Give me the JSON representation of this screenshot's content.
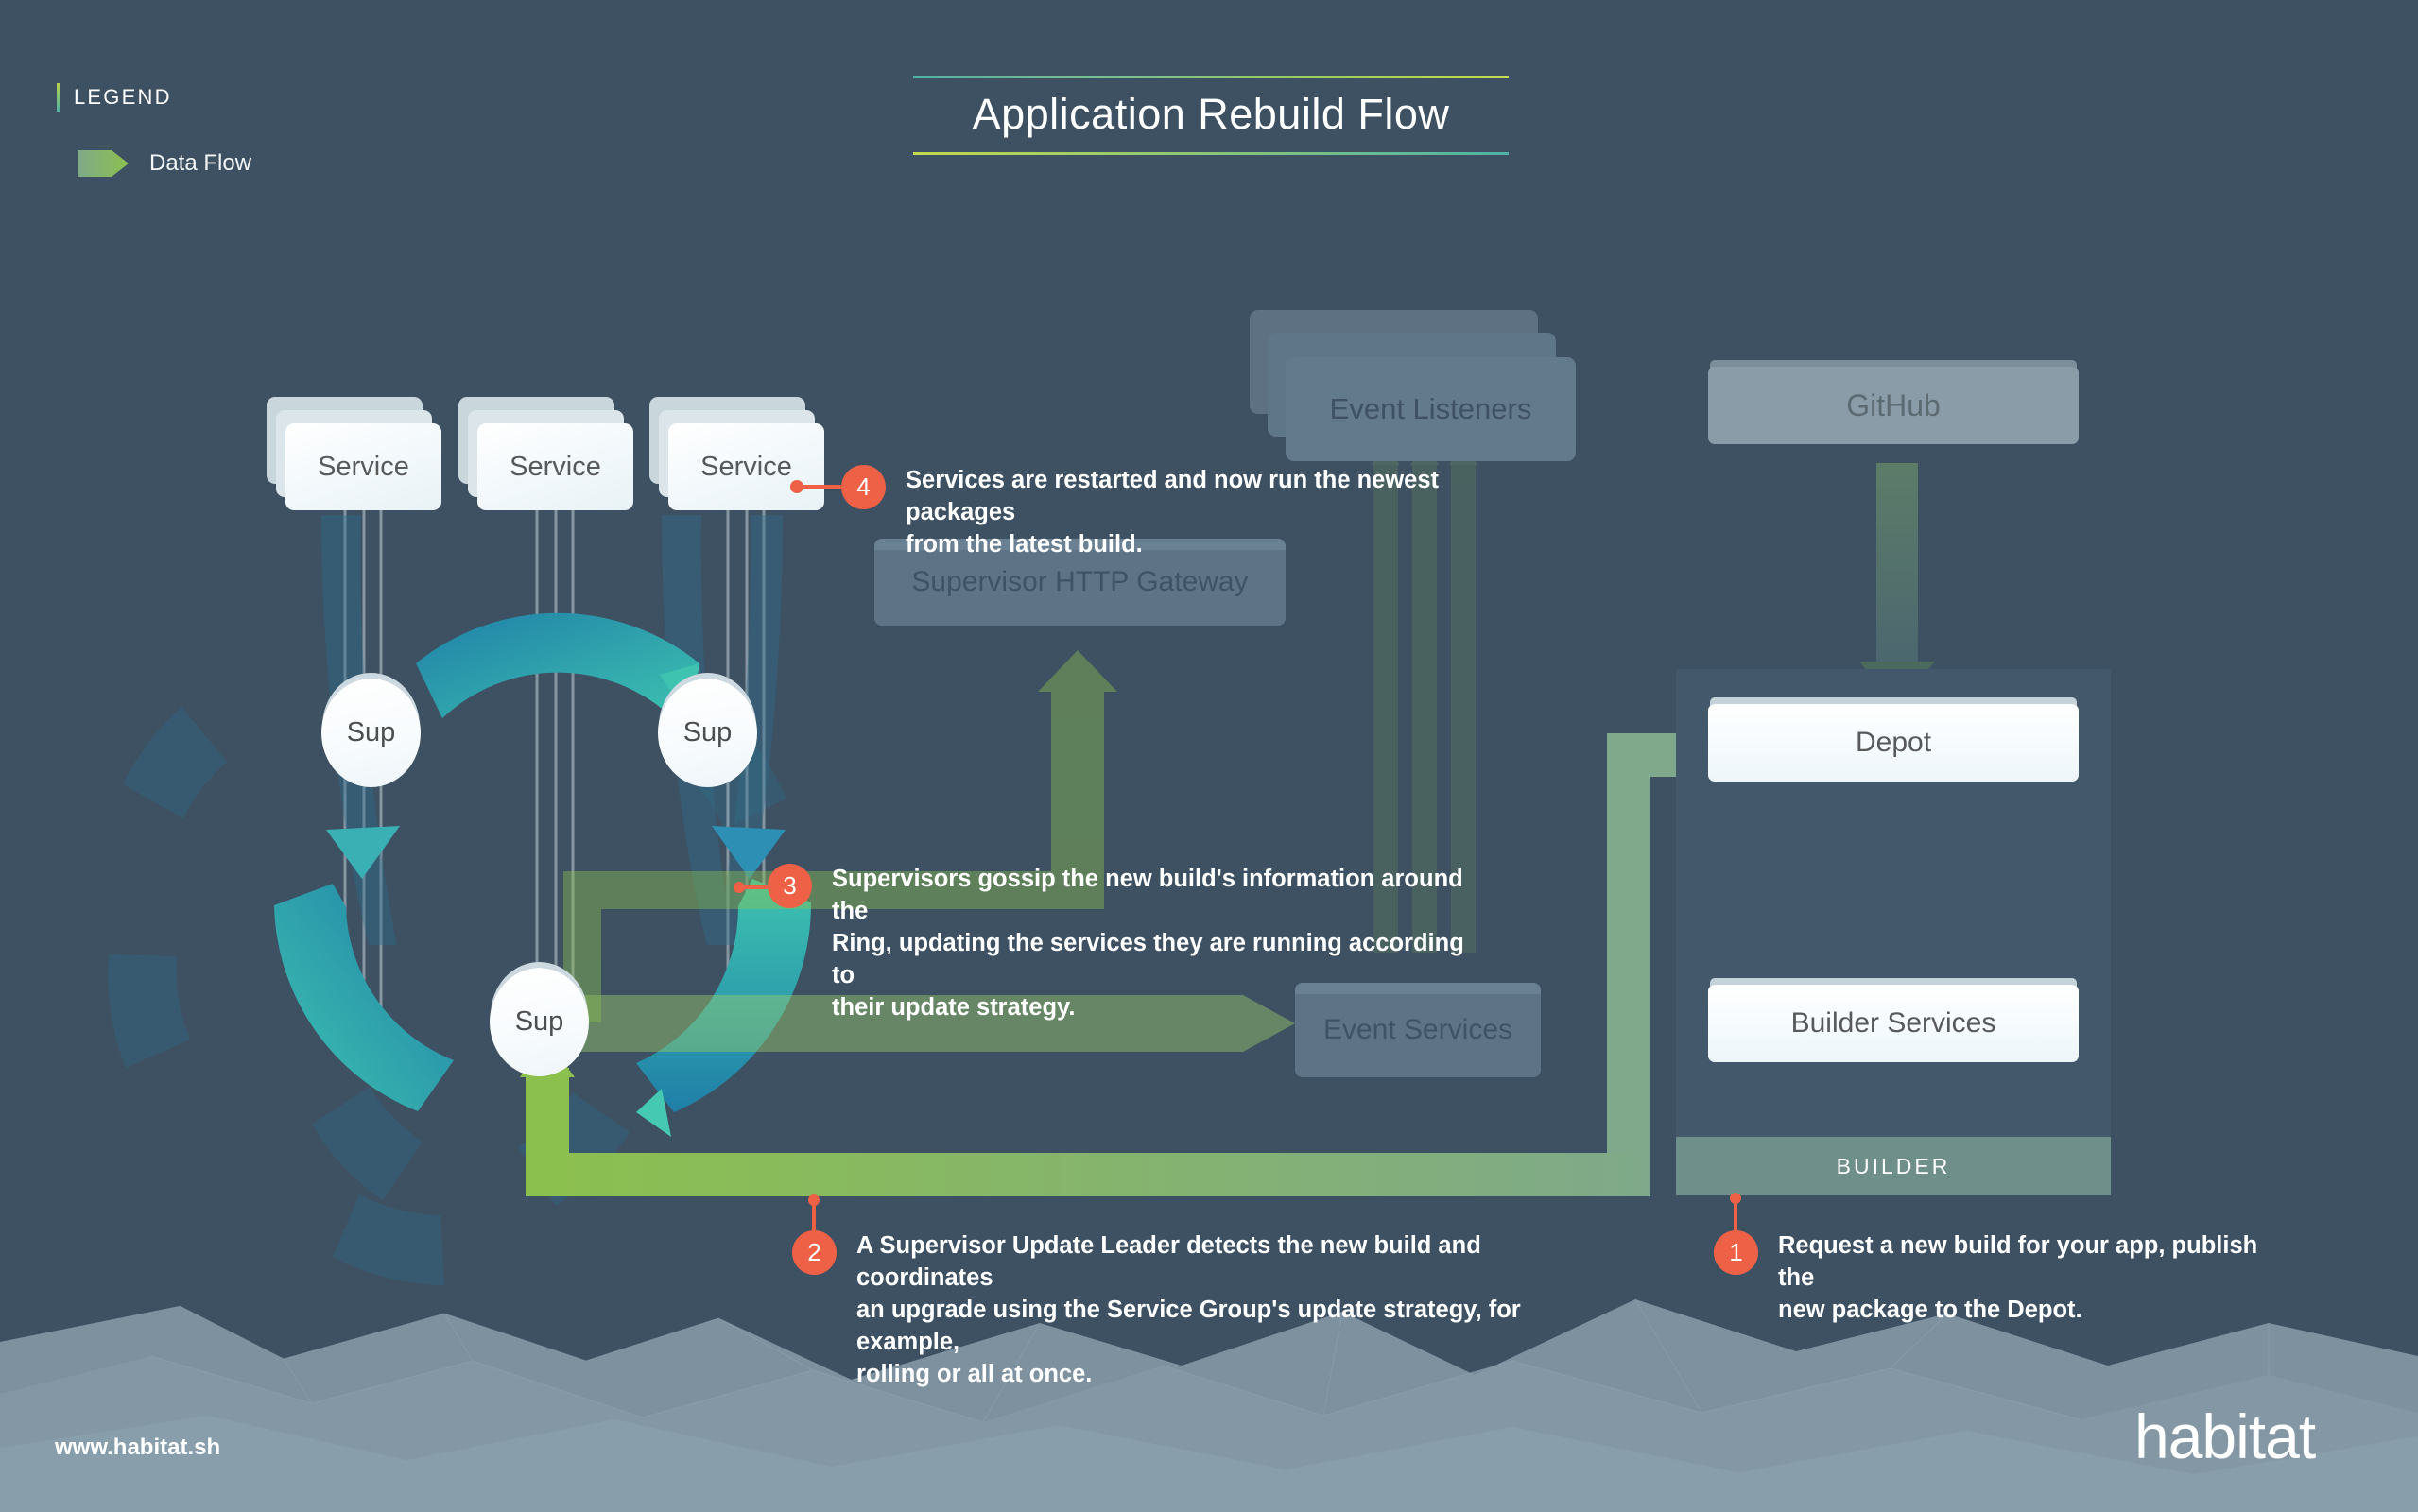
{
  "page": {
    "title": "Application Rebuild Flow",
    "site_url": "www.habitat.sh",
    "logo": "habitat",
    "background_color": "#3d5163"
  },
  "legend": {
    "title": "LEGEND",
    "items": [
      {
        "icon": "data-flow-arrow",
        "label": "Data Flow",
        "color": "#8cc04e"
      }
    ]
  },
  "colors": {
    "accent_orange": "#ef6146",
    "flow_green": "#8cc04e",
    "ring_teal": "#3ec3b0",
    "ring_blue": "#1f7fa8",
    "dim_gray": "#5e7486",
    "builder_footer": "#6f8f8a"
  },
  "nodes": {
    "services": [
      {
        "id": "service-1",
        "label": "Service",
        "state": "active"
      },
      {
        "id": "service-2",
        "label": "Service",
        "state": "active"
      },
      {
        "id": "service-3",
        "label": "Service",
        "state": "active"
      }
    ],
    "supervisors": [
      {
        "id": "sup-left",
        "label": "Sup"
      },
      {
        "id": "sup-right",
        "label": "Sup"
      },
      {
        "id": "sup-bottom",
        "label": "Sup"
      }
    ],
    "event_listeners": {
      "label": "Event Listeners",
      "state": "dimmed"
    },
    "supervisor_http_gateway": {
      "label": "Supervisor HTTP Gateway",
      "state": "dimmed"
    },
    "event_services": {
      "label": "Event Services",
      "state": "dimmed"
    },
    "github": {
      "label": "GitHub",
      "state": "dimmed"
    },
    "depot": {
      "label": "Depot",
      "state": "active"
    },
    "builder_services": {
      "label": "Builder Services",
      "state": "active"
    },
    "builder_panel": {
      "label": "BUILDER"
    }
  },
  "steps": [
    {
      "number": "1",
      "text": "Request a new build for your app, publish the\nnew package to the Depot."
    },
    {
      "number": "2",
      "text": "A Supervisor Update Leader detects the new build and coordinates\nan upgrade using the Service Group's update strategy, for example,\nrolling or all at once."
    },
    {
      "number": "3",
      "text": "Supervisors gossip the new build's information around the\nRing, updating the services they are running according to\ntheir update strategy."
    },
    {
      "number": "4",
      "text": "Services are restarted and now run the newest packages\nfrom the latest build."
    }
  ]
}
